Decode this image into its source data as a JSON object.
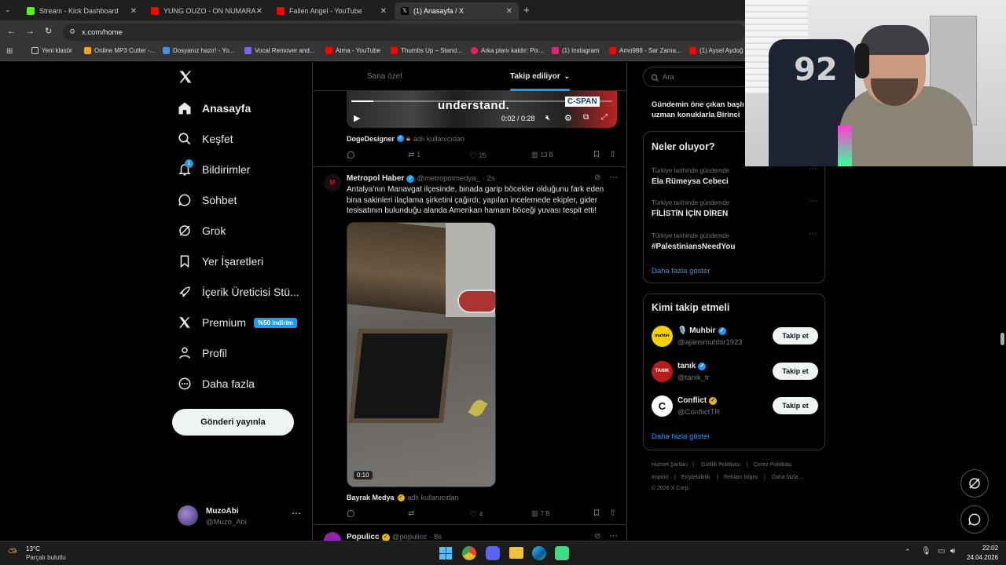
{
  "browser": {
    "tabs": [
      {
        "title": "Stream - Kick Dashboard",
        "color": "#53fc18"
      },
      {
        "title": "YUNG OUZO - ON NUMARA - ",
        "color": "#ff0000"
      },
      {
        "title": "Fallen Angel - YouTube",
        "color": "#ff0000"
      },
      {
        "title": "(1) Anasayfa / X",
        "color": "#ffffff"
      }
    ],
    "url": "x.com/home",
    "bookmarks": [
      {
        "label": "Yeni klasör",
        "color": "#cfcfcf"
      },
      {
        "label": "Online MP3 Cutter -...",
        "color": "#f5a623"
      },
      {
        "label": "Dosyanız hazır! - Yo...",
        "color": "#4a90e2"
      },
      {
        "label": "Vocal Remover and...",
        "color": "#7b61ff"
      },
      {
        "label": "Atma - YouTube",
        "color": "#ff0000"
      },
      {
        "label": "Thumbs Up – Stand...",
        "color": "#ff0000"
      },
      {
        "label": "Arka planı kaldır: Pix...",
        "color": "#e91e63"
      },
      {
        "label": "(1) Instagram",
        "color": "#d62976"
      },
      {
        "label": "Amo988 - Sar Zama...",
        "color": "#ff0000"
      },
      {
        "label": "(1) Aysel Aydoğ",
        "color": "#ff0000"
      }
    ]
  },
  "sidebar": {
    "logo": "X",
    "items": [
      {
        "label": "Anasayfa",
        "icon": "home-icon"
      },
      {
        "label": "Keşfet",
        "icon": "search-icon"
      },
      {
        "label": "Bildirimler",
        "icon": "bell-icon",
        "badge": "1"
      },
      {
        "label": "Sohbet",
        "icon": "chat-icon"
      },
      {
        "label": "Grok",
        "icon": "grok-icon"
      },
      {
        "label": "Yer İşaretleri",
        "icon": "bookmark-icon"
      },
      {
        "label": "İçerik Üreticisi Stü...",
        "icon": "rocket-icon"
      },
      {
        "label": "Premium",
        "icon": "x-icon",
        "badge": "%50 indirim"
      },
      {
        "label": "Profil",
        "icon": "person-icon"
      },
      {
        "label": "Daha fazla",
        "icon": "more-circle-icon"
      }
    ],
    "post_button": "Gönderi yayınla",
    "user": {
      "name": "MuzoAbi",
      "handle": "@Muzo_Abi"
    }
  },
  "feed": {
    "tabs": [
      "Sana özel",
      "Takip ediliyor"
    ],
    "video1": {
      "overlay_text": "understand.",
      "time": "0:02 / 0:28",
      "brand": "C-SPAN"
    },
    "tweet1": {
      "repost_by": "DogeDesigner",
      "repost_suffix": "adlı kullanıcıdan",
      "reposts": "1",
      "likes": "25",
      "views": "13 B"
    },
    "tweet2": {
      "name": "Metropol Haber",
      "handle": "@metropolmedya_",
      "time": "· 2s",
      "text_lines": [
        "Antalya'nın Manavgat ilçesinde, binada garip böcekler olduğunu fark eden",
        "bina sakinleri ilaçlama şirketini çağırdı; yapılan incelemede ekipler, gider",
        "tesisatının bulunduğu alanda Amerikan hamam böceği yuvası tespit etti!"
      ],
      "video_time": "0:10",
      "repost_by": "Bayrak Medya",
      "repost_suffix": "adlı kullanıcıdan",
      "likes": "4",
      "views": "7 B"
    },
    "tweet3": {
      "name": "Populicc",
      "handle": "@populicc",
      "time": "· 8s"
    }
  },
  "right": {
    "search_placeholder": "Ara",
    "news_snippet": [
      "Gündemin öne çıkan başlı",
      "uzman konuklarla Birinci"
    ],
    "trends_title": "Neler oluyor?",
    "trends": [
      {
        "sub": "Türkiye tarihinde gündemde",
        "title": "Ela Rümeysa Cebeci"
      },
      {
        "sub": "Türkiye tarihinde gündemde",
        "title": "FİLİSTİN İÇİN DİREN"
      },
      {
        "sub": "Türkiye tarihinde gündemde",
        "title": "#PalestiniansNeedYou"
      }
    ],
    "show_more": "Daha fazla göster",
    "follow_title": "Kimi takip etmeli",
    "follow": [
      {
        "name": "🎙️ Muhbir",
        "handle": "@ajansmuhbir1923",
        "btn": "Takip et",
        "avatar_color": "#f5d000",
        "avatar_text": "muhbir"
      },
      {
        "name": "tanık",
        "handle": "@tanik_tr",
        "btn": "Takip et",
        "avatar_color": "#b71c1c",
        "avatar_text": "TANIK"
      },
      {
        "name": "Conflict",
        "handle": "@ConflictTR",
        "btn": "Takip et",
        "avatar_color": "#ffffff",
        "avatar_text": "C"
      }
    ],
    "follow_more": "Daha fazla göster",
    "footer": [
      "Hizmet Şartları",
      "Gizlilik Politikası",
      "Çerez Politikası",
      "Imprint",
      "Erişilebilirlik",
      "Reklam bilgisi",
      "Daha fazla ...",
      "© 2026 X Corp."
    ]
  },
  "taskbar": {
    "weather_temp": "13°C",
    "weather_desc": "Parçalı bulutlu",
    "time": "22:02",
    "date": "24.04.2026"
  }
}
